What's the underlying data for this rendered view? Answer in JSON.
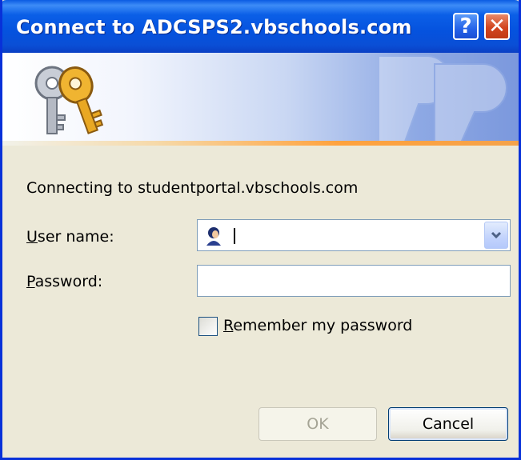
{
  "window": {
    "title": "Connect to ADCSPS2.vbschools.com",
    "help_label": "?",
    "close_label": "✕"
  },
  "banner": {
    "icon": "keys-icon",
    "watermark": "keys-watermark",
    "accent_color": "#ffa23e"
  },
  "dialog": {
    "message": "Connecting to studentportal.vbschools.com",
    "username": {
      "label_first": "U",
      "label_rest": "ser name:",
      "value": "",
      "icon": "user-icon",
      "dropdown_icon": "chevron-down-icon"
    },
    "password": {
      "label_first": "P",
      "label_rest": "assword:",
      "value": ""
    },
    "remember": {
      "label_first": "R",
      "label_rest": "emember my password",
      "checked": false
    }
  },
  "buttons": {
    "ok": "OK",
    "cancel": "Cancel"
  },
  "colors": {
    "titlebar": "#0552de",
    "dialog_bg": "#ece9d8",
    "field_border": "#7f9db9"
  }
}
